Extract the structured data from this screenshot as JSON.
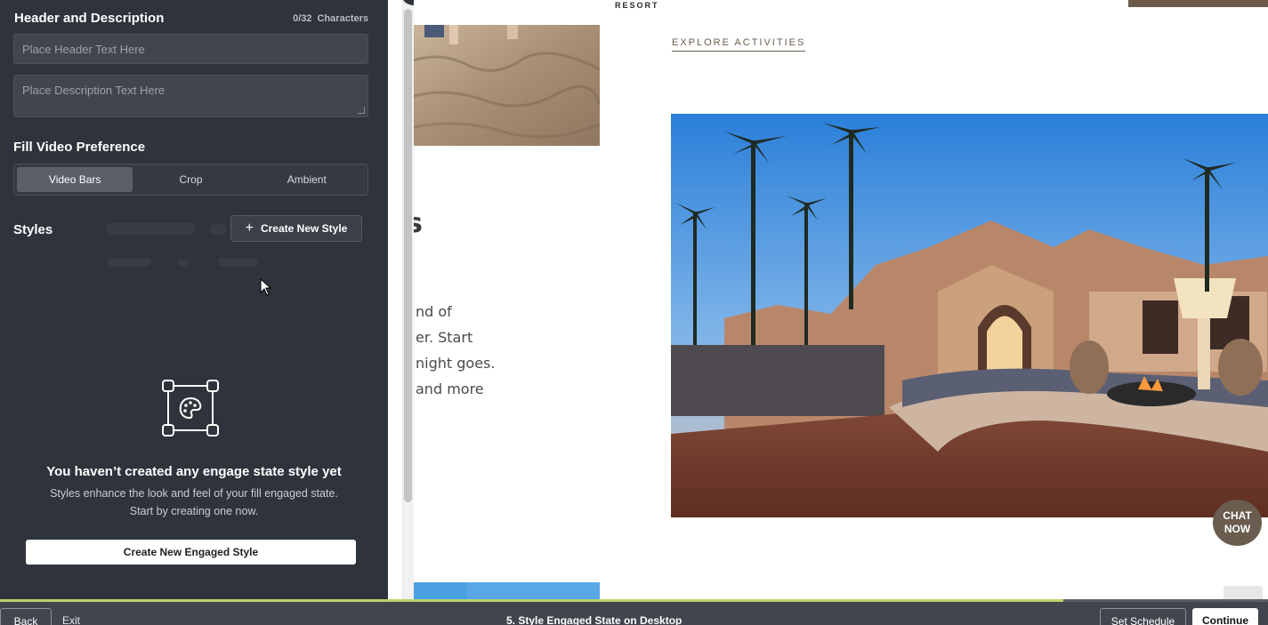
{
  "sidebar": {
    "header_title": "Header and Description",
    "char_count": "0/32",
    "char_label": "Characters",
    "header_placeholder": "Place Header Text Here",
    "description_placeholder": "Place Description Text Here",
    "fill_title": "Fill Video Preference",
    "fill_options": [
      "Video Bars",
      "Crop",
      "Ambient"
    ],
    "fill_selected": "Video Bars",
    "styles_title": "Styles",
    "create_style_label": "Create New Style",
    "empty_title": "You haven’t created any engage state style yet",
    "empty_desc_1": "Styles enhance the look and feel of your fill engaged state.",
    "empty_desc_2": "Start by creating one now.",
    "create_engaged_label": "Create New Engaged Style"
  },
  "preview": {
    "resort_label": "RESORT",
    "explore_link": "EXPLORE ACTIVITIES",
    "heading_fragment": "s",
    "body_lines": [
      "nd of",
      "er. Start",
      "night goes.",
      "and more"
    ],
    "chat_line1": "CHAT",
    "chat_line2": "NOW",
    "brand_color": "#6b5a4a"
  },
  "bottombar": {
    "back_label": "Back",
    "exit_label": "Exit",
    "step_title": "5. Style Engaged State on Desktop",
    "schedule_label": "Set Schedule",
    "continue_label": "Continue",
    "progress_color": "#b8d56a"
  },
  "icons": [
    "plus-icon",
    "cursor-icon",
    "palette-icon",
    "resize-grip-icon"
  ]
}
